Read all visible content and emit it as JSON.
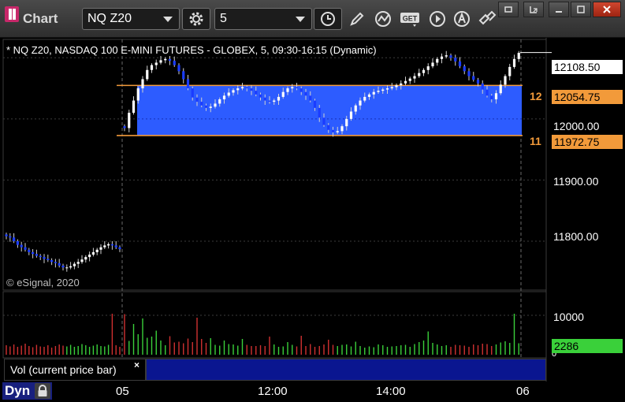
{
  "window": {
    "app_title": "Chart",
    "symbol": "NQ Z20",
    "interval": "5"
  },
  "toolbar_icons": [
    "settings-gear-icon",
    "clock-icon",
    "pencil-icon",
    "study-wave-icon",
    "get-icon",
    "play-icon",
    "annotation-a-icon",
    "link-icon"
  ],
  "chart": {
    "description": "* NQ Z20, NASDAQ 100 E-MINI FUTURES - GLOBEX, 5, 09:30-16:15 (Dynamic)",
    "copyright": "© eSignal, 2020",
    "price_axis_labels": [
      "12000.00",
      "11900.00",
      "11800.00"
    ],
    "last_price": "12108.50",
    "upper_level": "12054.75",
    "upper_level_cut": "12",
    "lower_level": "11972.75",
    "lower_level_cut": "11",
    "colors": {
      "up": "#ffffff",
      "down": "#1a3cff",
      "band": "#2d5cff",
      "level": "#f29a3a"
    }
  },
  "volume": {
    "title": "Vol (current price bar)",
    "close_glyph": "×",
    "axis_label": "10000",
    "zero_label": "0",
    "current_value": "2286",
    "colors": {
      "up": "#3ad03a",
      "down": "#d03030"
    }
  },
  "time_axis": {
    "labels": [
      "05",
      "12:00",
      "14:00",
      "06"
    ]
  },
  "bottom": {
    "mode_label": "Dyn"
  },
  "chart_data": {
    "type": "candlestick",
    "title": "* NQ Z20, NASDAQ 100 E-MINI FUTURES - GLOBEX, 5, 09:30-16:15 (Dynamic)",
    "ylim": [
      11720,
      12130
    ],
    "y_ticks": [
      12000,
      11900,
      11800
    ],
    "x_ticks": [
      "05",
      "12:00",
      "14:00",
      "06"
    ],
    "last_price": 12108.5,
    "horizontal_lines": [
      12054.75,
      11972.75
    ],
    "session_a_closes": [
      11808,
      11806,
      11800,
      11794,
      11790,
      11786,
      11782,
      11779,
      11776,
      11774,
      11771,
      11769,
      11766,
      11764,
      11760,
      11757,
      11757,
      11759,
      11763,
      11766,
      11770,
      11774,
      11778,
      11782,
      11786,
      11790,
      11793,
      11795,
      11793,
      11790,
      11787
    ],
    "session_b_closes": [
      11985,
      12010,
      12030,
      12050,
      12065,
      12080,
      12088,
      12092,
      12096,
      12098,
      12095,
      12088,
      12078,
      12065,
      12050,
      12035,
      12028,
      12022,
      12018,
      12020,
      12025,
      12032,
      12038,
      12043,
      12047,
      12050,
      12052,
      12050,
      12046,
      12040,
      12035,
      12030,
      12028,
      12030,
      12036,
      12044,
      12050,
      12052,
      12050,
      12044,
      12038,
      12030,
      12018,
      12002,
      11990,
      11982,
      11978,
      11980,
      11988,
      12000,
      12012,
      12022,
      12030,
      12036,
      12040,
      12044,
      12046,
      12048,
      12050,
      12052,
      12055,
      12058,
      12062,
      12066,
      12070,
      12075,
      12080,
      12086,
      12092,
      12098,
      12102,
      12104,
      12100,
      12094,
      12086,
      12078,
      12070,
      12064,
      12058,
      12048,
      12038,
      12032,
      12042,
      12056,
      12070,
      12085,
      12098,
      12108
    ],
    "volume_a": [
      2400,
      2100,
      2600,
      2000,
      2300,
      2800,
      2200,
      1900,
      2500,
      2100,
      2000,
      2400,
      1800,
      2200,
      2600,
      2300,
      2100,
      2500,
      2000,
      2200,
      2700,
      2400,
      2000,
      2300,
      2600,
      2200,
      2100,
      2500,
      10400,
      2400,
      2000
    ],
    "volume_b": [
      10300,
      3500,
      7800,
      5200,
      9200,
      4300,
      4600,
      6100,
      3600,
      2400,
      4700,
      3100,
      3300,
      2900,
      4100,
      3200,
      9400,
      4000,
      3000,
      4200,
      2500,
      2300,
      3600,
      2700,
      2600,
      2300,
      4000,
      2500,
      2200,
      2200,
      2400,
      2200,
      4600,
      2600,
      2000,
      2100,
      3200,
      2500,
      2100,
      4800,
      2200,
      2700,
      2000,
      2200,
      2600,
      3800,
      2500,
      2200,
      2500,
      2600,
      2100,
      3300,
      2200,
      1800,
      2100,
      1900,
      2600,
      2400,
      2000,
      2100,
      2200,
      2400,
      2500,
      2000,
      2700,
      3200,
      3600,
      5900,
      3000,
      2600,
      2200,
      2400,
      2000,
      2500,
      2400,
      2300,
      2000,
      2600,
      2400,
      2800,
      2700,
      2200,
      2600,
      3100,
      3400,
      3000,
      10400,
      2900,
      2400,
      3800,
      1800,
      2286
    ]
  }
}
